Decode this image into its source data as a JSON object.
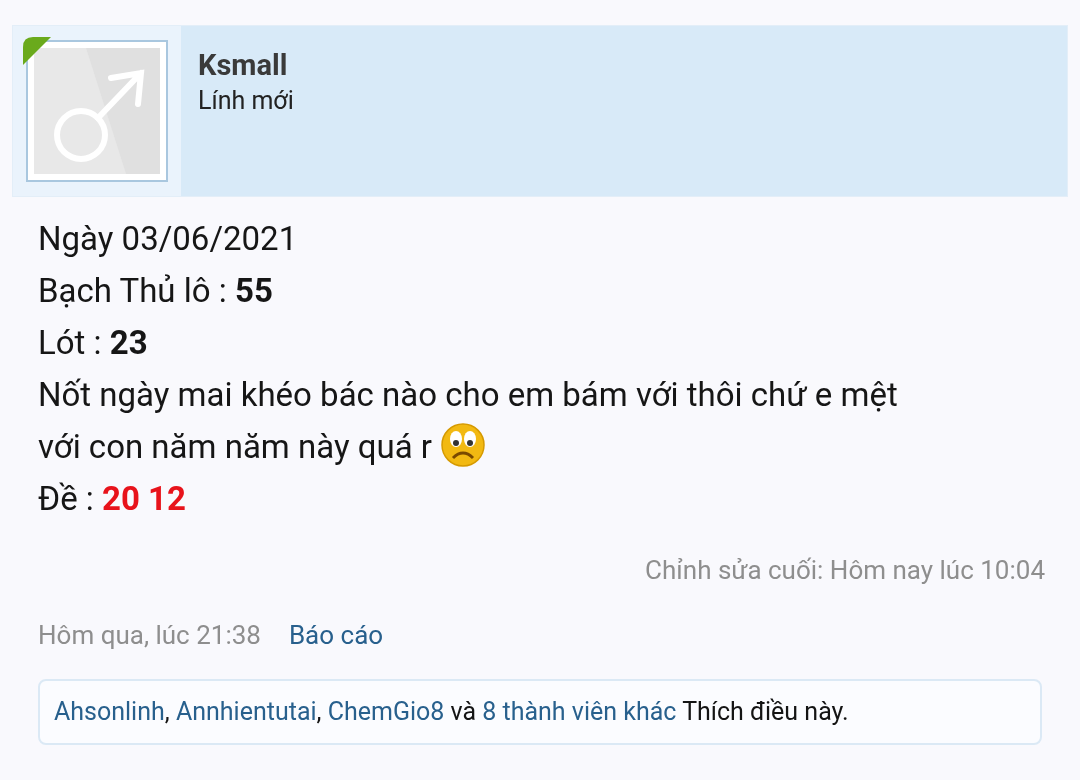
{
  "author": {
    "name": "Ksmall",
    "rank": "Lính mới"
  },
  "body": [
    {
      "kind": "plain",
      "text": "Ngày 03/06/2021"
    },
    {
      "kind": "bold",
      "text": "Bạch Thủ lô : ",
      "value": "55"
    },
    {
      "kind": "bold",
      "text": "Lót : ",
      "value": "23"
    },
    {
      "kind": "plain",
      "text": "Nốt ngày mai khéo bác nào cho em bám với thôi chứ e mệt"
    },
    {
      "kind": "emoji",
      "text": "với con năm năm này quá r"
    },
    {
      "kind": "red",
      "text": "Đề : ",
      "value": "20 12"
    }
  ],
  "edited": "Chỉnh sửa cuối: Hôm nay lúc 10:04",
  "posted": "Hôm qua, lúc 21:38",
  "report_link": "Báo cáo",
  "likes": {
    "names": [
      "Ahsonlinh",
      "Annhientutai",
      "ChemGio8"
    ],
    "separator": ", ",
    "joiner": " và ",
    "others": "8 thành viên khác",
    "suffix": " Thích điều này."
  }
}
